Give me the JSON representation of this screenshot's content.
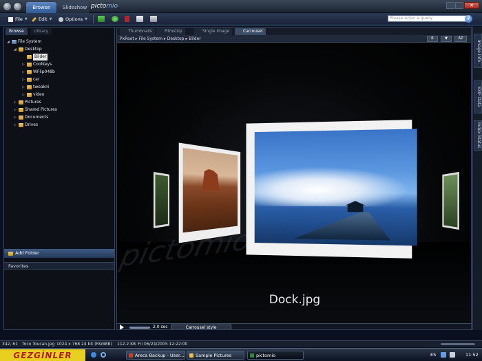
{
  "titlebar": {
    "modes": [
      {
        "label": "Browse"
      },
      {
        "label": "Slideshow"
      }
    ],
    "logo_main": "picto",
    "logo_accent": "mio",
    "search_placeholder": "Please enter a query"
  },
  "toolbar": {
    "file_label": "File",
    "edit_label": "Edit",
    "options_label": "Options",
    "help_label": "?"
  },
  "left": {
    "tabs": [
      {
        "label": "Browse"
      },
      {
        "label": "Library"
      }
    ],
    "tree": [
      {
        "label": "File System"
      },
      {
        "label": "Desktop"
      },
      {
        "label": "Bilder"
      },
      {
        "label": "CoolKeys"
      },
      {
        "label": "WFlip048b"
      },
      {
        "label": "car"
      },
      {
        "label": "tweakni"
      },
      {
        "label": "video"
      },
      {
        "label": "Pictures"
      },
      {
        "label": "Shared Pictures"
      },
      {
        "label": "Documents"
      },
      {
        "label": "Drives"
      }
    ],
    "add_folder": "Add Folder",
    "favorites": "Favorites"
  },
  "viewer": {
    "tabs": [
      {
        "label": "Thumbnails"
      },
      {
        "label": "Filmstrip"
      },
      {
        "label": "Single Image"
      },
      {
        "label": "Carrousel"
      }
    ],
    "breadcrumb": "PxRoot ▸ File System ▸ Desktop ▸ Bilder",
    "sort_buttons": [
      "R",
      "▼",
      "AZ"
    ],
    "watermark": "pictomio",
    "caption": "Dock.jpg",
    "speed": "2.0 sec",
    "style_select": "Carrousel style"
  },
  "rightbar": {
    "tabs": [
      {
        "label": "Image Info"
      },
      {
        "label": "EXIF Data"
      },
      {
        "label": "Index Status"
      }
    ]
  },
  "status": {
    "coords": "342, 61",
    "filename": "Toco Toucan.jpg",
    "dims": "1024 x 768 24 bit (RGB8B)",
    "size": "112.2 KB",
    "date": "Fri 06/24/2005 12:22:00"
  },
  "taskbar": {
    "brand": "GEZGİNLER",
    "tasks": [
      {
        "label": "Areca Backup - User..."
      },
      {
        "label": "Sample Pictures"
      },
      {
        "label": "pictomio"
      }
    ],
    "lang": "ES",
    "clock": "11:52"
  }
}
